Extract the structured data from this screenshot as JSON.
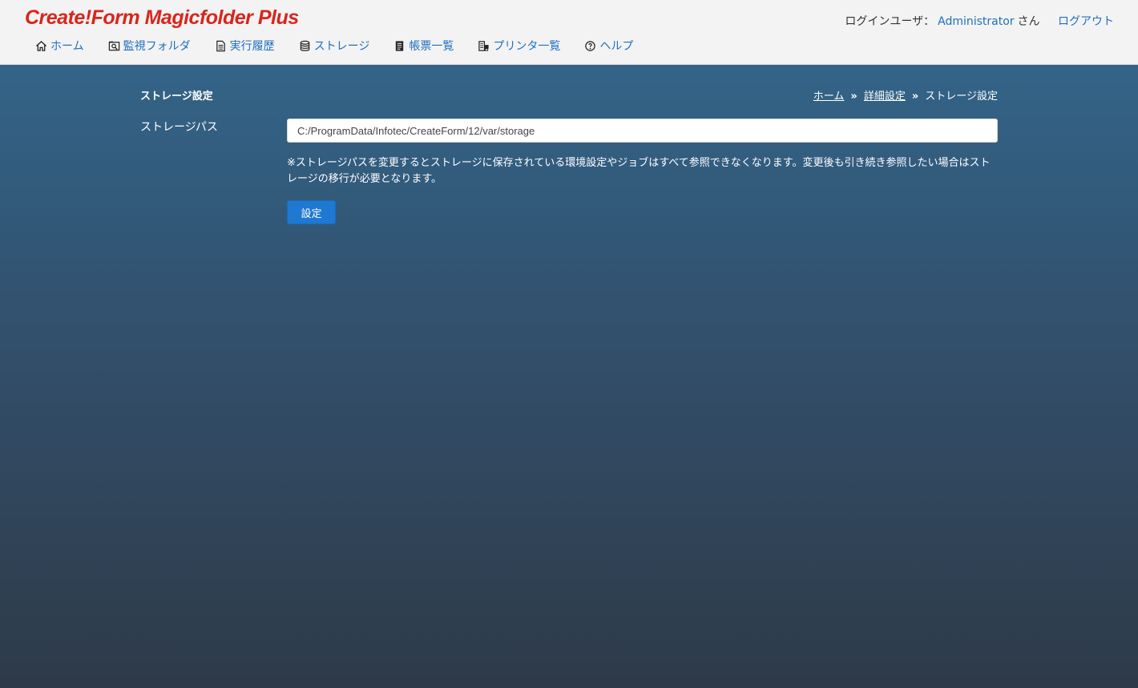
{
  "app": {
    "title": "Create!Form Magicfolder Plus"
  },
  "user": {
    "label": "ログインユーザ：",
    "name": "Administrator",
    "suffix": "さん",
    "logout": "ログアウト"
  },
  "nav": {
    "items": [
      {
        "label": "ホーム",
        "icon": "home-icon"
      },
      {
        "label": "監視フォルダ",
        "icon": "folder-search-icon"
      },
      {
        "label": "実行履歴",
        "icon": "document-icon"
      },
      {
        "label": "ストレージ",
        "icon": "database-icon"
      },
      {
        "label": "帳票一覧",
        "icon": "form-list-icon"
      },
      {
        "label": "プリンタ一覧",
        "icon": "printer-icon"
      },
      {
        "label": "ヘルプ",
        "icon": "help-icon"
      }
    ]
  },
  "page": {
    "title": "ストレージ設定",
    "breadcrumb": {
      "home": "ホーム",
      "advanced": "詳細設定",
      "current": "ストレージ設定",
      "separator": "»"
    },
    "storage_path_label": "ストレージパス",
    "storage_path_value": "C:/ProgramData/Infotec/CreateForm/12/var/storage",
    "note": "※ストレージパスを変更するとストレージに保存されている環境設定やジョブはすべて参照できなくなります。変更後も引き続き参照したい場合はストレージの移行が必要となります。",
    "submit_label": "設定"
  },
  "colors": {
    "brand": "#d9251c",
    "link": "#1f6fc0",
    "primary_button": "#1f78d1"
  }
}
